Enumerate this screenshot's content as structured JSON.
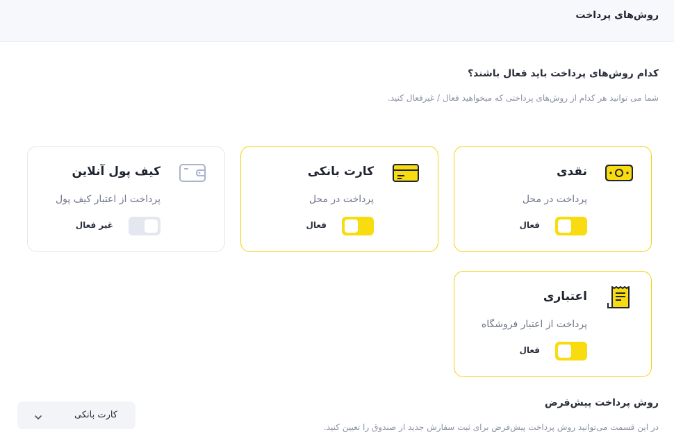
{
  "header": {
    "title": "روش‌های پرداخت"
  },
  "question": {
    "title": "کدام روش‌های پرداخت باید فعال باشند؟",
    "description": "شما می توانید هر کدام از روش‌های پرداختی که میخواهید فعال / غیرفعال کنید."
  },
  "methods": [
    {
      "title": "نقدی",
      "subtitle": "پرداخت در محل",
      "status": "فعال",
      "enabled": true,
      "icon": "cash-icon"
    },
    {
      "title": "کارت بانکی",
      "subtitle": "پرداخت در محل",
      "status": "فعال",
      "enabled": true,
      "icon": "bank-card-icon"
    },
    {
      "title": "کیف پول آنلاین",
      "subtitle": "پرداخت از اعتبار کیف پول",
      "status": "غیر فعال",
      "enabled": false,
      "icon": "wallet-icon"
    },
    {
      "title": "اعتباری",
      "subtitle": "پرداخت از اعتبار فروشگاه",
      "status": "فعال",
      "enabled": true,
      "icon": "receipt-icon"
    }
  ],
  "default_method": {
    "title": "روش پرداخت پیش‌فرض",
    "description": "در این قسمت می‌توانید روش پرداخت پیش‌فرض برای ثبت سفارش جدید از صندوق را تعیین کنید.",
    "selected": "کارت بانکی"
  },
  "colors": {
    "accent": "#f9dc0f",
    "active_border": "#f6d20b",
    "inactive": "#e4e7f0"
  }
}
